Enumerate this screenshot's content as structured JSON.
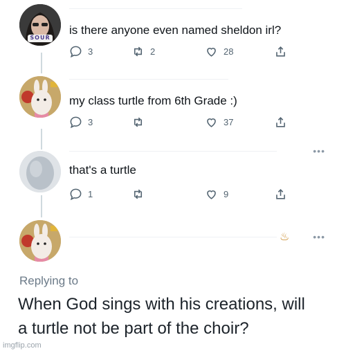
{
  "tweets": [
    {
      "text": "is there anyone even named sheldon irl?",
      "avatar_badge": "SOUR",
      "replies": "3",
      "retweets": "2",
      "likes": "28"
    },
    {
      "text": "my class turtle from 6th Grade :)",
      "replies": "3",
      "retweets": "",
      "likes": "37"
    },
    {
      "text": "that's a turtle",
      "replies": "1",
      "retweets": "",
      "likes": "9"
    }
  ],
  "reply": {
    "replying_to": "Replying to",
    "line1": "When God sings with his creations, will",
    "line2": "a turtle not be part of the choir?"
  },
  "watermark": "imgflip.com",
  "colors": {
    "text": "#0f1419",
    "muted": "#536471",
    "thread": "#cfd9de"
  },
  "icons": [
    "reply-icon",
    "retweet-icon",
    "like-icon",
    "share-icon",
    "more-icon"
  ]
}
